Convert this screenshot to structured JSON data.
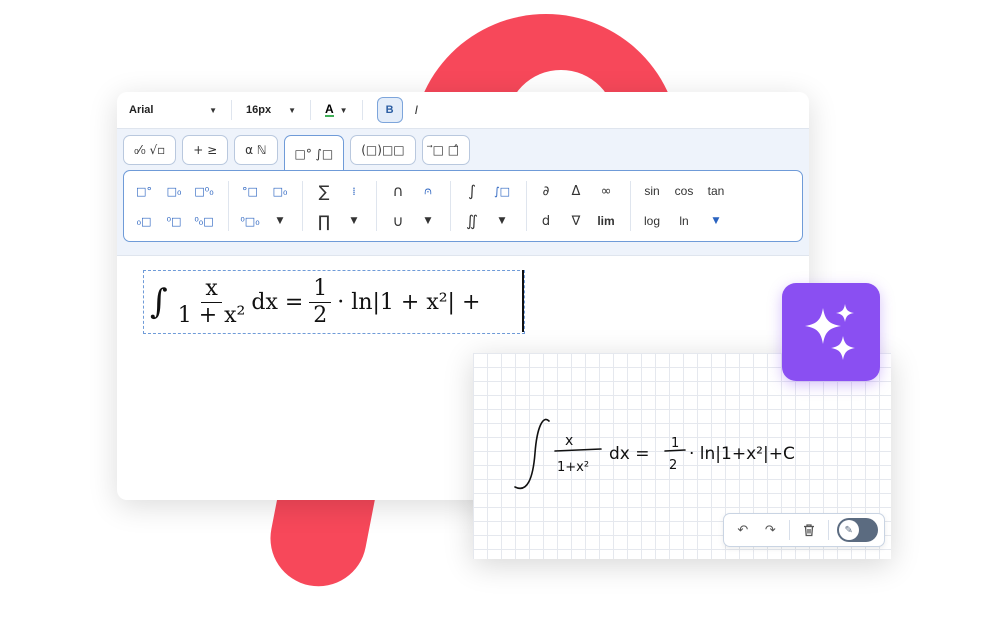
{
  "format_bar": {
    "font": "Arial",
    "size": "16px",
    "color_letter": "A",
    "bold": "B",
    "italic": "I"
  },
  "tabs": [
    {
      "label": "₀⁄₀ √▫",
      "active": false
    },
    {
      "label": "+ ≥",
      "active": false
    },
    {
      "label": "α ℕ",
      "active": false
    },
    {
      "label": "□° ∫□",
      "active": true
    },
    {
      "label": "(□)□□",
      "active": false
    },
    {
      "label": "⃗□ □̂",
      "active": false
    }
  ],
  "symbols": {
    "big_ops": [
      "∑",
      "∏"
    ],
    "sets": [
      "∩",
      "∪"
    ],
    "integrals": [
      "∫",
      "∬"
    ],
    "calculus": [
      "∂",
      "Δ",
      "∞",
      "d",
      "∇",
      "lim"
    ],
    "functions": [
      "sin",
      "cos",
      "tan",
      "log",
      "ln"
    ]
  },
  "formula": {
    "int": "∫",
    "num1": "x",
    "den1": "1 + x²",
    "dx": "dx =",
    "num2": "1",
    "den2": "2",
    "tail": "· ln|1 + x²| +"
  },
  "handwriting": {
    "text": "∫ x/(1+x²) dx = 1/2 · ln|1+x²| + C"
  },
  "hw_toolbar": {
    "undo": "↶",
    "redo": "↷",
    "delete": "🗑"
  },
  "colors": {
    "accent": "#6f9bd8",
    "brand_red": "#f7485a",
    "ai_purple": "#8a4ff2"
  }
}
